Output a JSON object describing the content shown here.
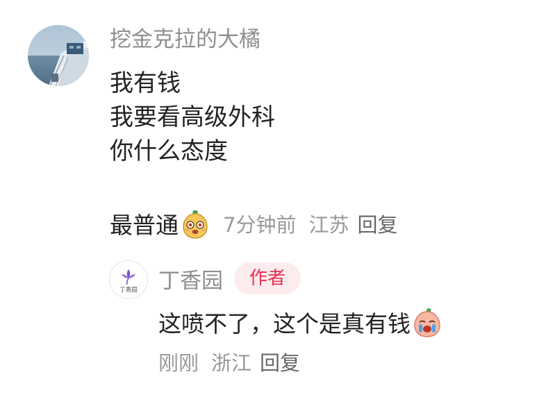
{
  "comment": {
    "username": "挖金克拉的大橘",
    "lines": [
      "我有钱",
      "我要看高级外科",
      "你什么态度"
    ],
    "footer_text": "最普通",
    "sticker": "surprised-fruit-sticker",
    "time": "7分钟前",
    "location": "江苏",
    "reply_label": "回复"
  },
  "reply": {
    "username": "丁香园",
    "avatar_text": "丁香园",
    "badge": "作者",
    "text": "这喷不了，这个是真有钱",
    "sticker": "crying-peach-sticker",
    "time": "刚刚",
    "location": "浙江",
    "reply_label": "回复"
  },
  "colors": {
    "badge_bg": "#fdecee",
    "badge_text": "#e8304f",
    "meta_gray": "#999999",
    "primary_text": "#222222",
    "logo_purple": "#7b4fc7"
  }
}
